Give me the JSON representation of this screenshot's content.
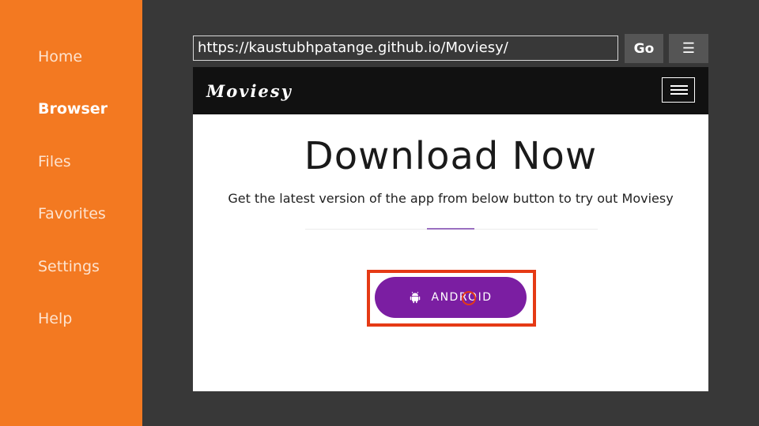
{
  "sidebar": {
    "items": [
      {
        "label": "Home",
        "active": false
      },
      {
        "label": "Browser",
        "active": true
      },
      {
        "label": "Files",
        "active": false
      },
      {
        "label": "Favorites",
        "active": false
      },
      {
        "label": "Settings",
        "active": false
      },
      {
        "label": "Help",
        "active": false
      }
    ]
  },
  "toolbar": {
    "url": "https://kaustubhpatange.github.io/Moviesy/",
    "go_label": "Go",
    "menu_icon": "hamburger-menu-icon"
  },
  "site": {
    "logo": "Moviesy",
    "nav_icon": "hamburger-menu-icon",
    "title": "Download Now",
    "subtitle": "Get the latest version of the app from below button to try out Moviesy",
    "download_button_label": "ANDROID",
    "download_icon": "android-icon"
  },
  "colors": {
    "sidebar_bg": "#f37921",
    "app_bg": "#383838",
    "button_purple": "#7b1ea2",
    "highlight_red": "#e53a15",
    "accent_line": "#9a6fc0"
  }
}
